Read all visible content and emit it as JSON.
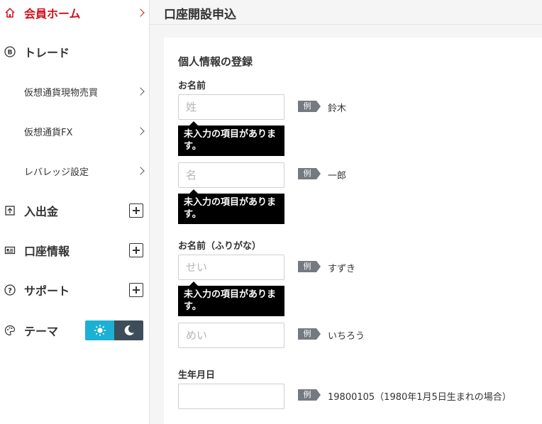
{
  "sidebar": {
    "home": {
      "label": "会員ホーム"
    },
    "trade": {
      "label": "トレード"
    },
    "trade_items": [
      {
        "label": "仮想通貨現物売買"
      },
      {
        "label": "仮想通貨FX"
      },
      {
        "label": "レバレッジ設定"
      }
    ],
    "deposit": {
      "label": "入出金"
    },
    "account": {
      "label": "口座情報"
    },
    "support": {
      "label": "サポート"
    },
    "theme": {
      "label": "テーマ",
      "selected": "light"
    }
  },
  "header": {
    "title": "口座開設申込"
  },
  "form": {
    "section_title": "個人情報の登録",
    "error_message": "未入力の項目があります。",
    "example_tag": "例",
    "name_label": "お名前",
    "last_name": {
      "placeholder": "姓",
      "value": "",
      "example": "鈴木"
    },
    "first_name": {
      "placeholder": "名",
      "value": "",
      "example": "一郎"
    },
    "kana_label": "お名前（ふりがな）",
    "last_kana": {
      "placeholder": "せい",
      "value": "",
      "example": "すずき"
    },
    "first_kana": {
      "placeholder": "めい",
      "value": "",
      "example": "いちろう"
    },
    "birth_label": "生年月日",
    "birth": {
      "placeholder": "",
      "value": "",
      "example": "19800105（1980年1月5日生まれの場合）"
    }
  },
  "colors": {
    "accent_red": "#d0121b",
    "toggle_light": "#1bb0d4",
    "toggle_dark": "#3d4d5a",
    "tooltip_bg": "#000000"
  }
}
